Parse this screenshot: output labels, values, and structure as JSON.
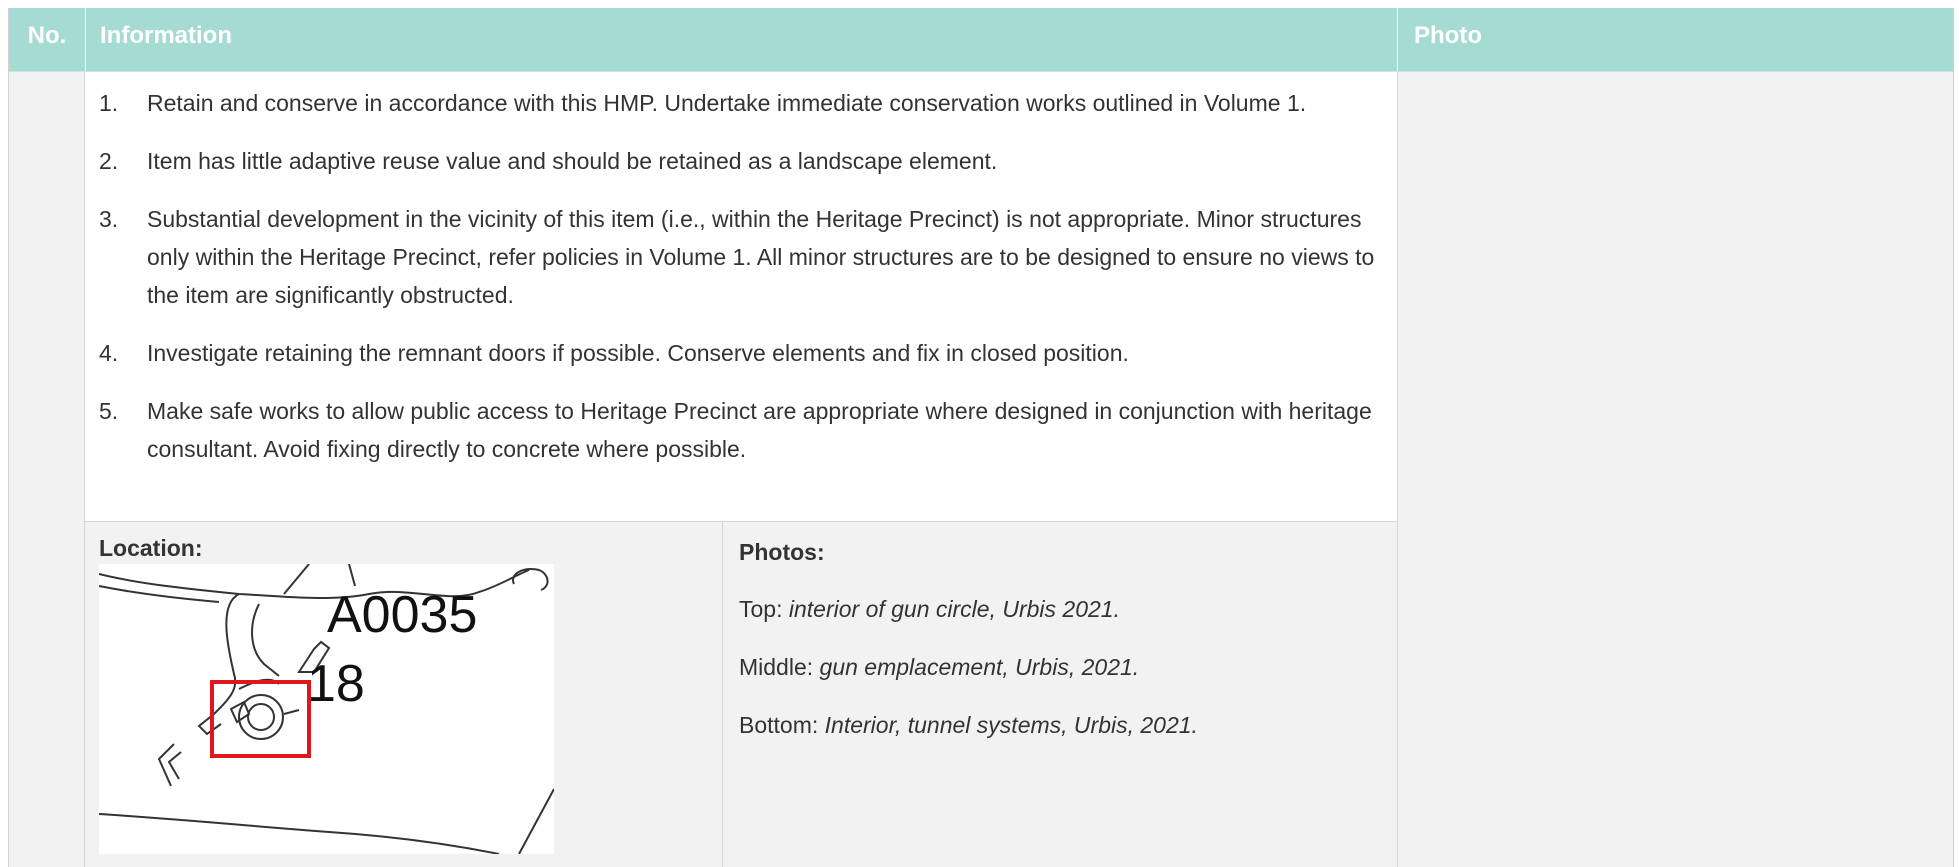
{
  "header": {
    "no": "No.",
    "information": "Information",
    "photo": "Photo"
  },
  "policies": [
    {
      "num": "1.",
      "text": "Retain and conserve in accordance with this HMP. Undertake immediate conservation works outlined in Volume 1."
    },
    {
      "num": "2.",
      "text": "Item has little adaptive reuse value and should be retained as a landscape element."
    },
    {
      "num": "3.",
      "text": "Substantial development in the vicinity of this item (i.e., within the Heritage Precinct) is not appropriate. Minor structures only within the Heritage Precinct, refer policies in Volume 1. All minor structures are to be designed to ensure no views to the item are significantly obstructed."
    },
    {
      "num": "4.",
      "text": "Investigate retaining the remnant doors if possible. Conserve elements and fix in closed position."
    },
    {
      "num": "5.",
      "text": "Make safe works to allow public access to Heritage Precinct are appropriate where designed in conjunction with heritage consultant. Avoid fixing directly to concrete where possible."
    }
  ],
  "location": {
    "label": "Location:",
    "map": {
      "area_label": "A0035",
      "item_label": "18",
      "highlight_color": "#e0161b"
    }
  },
  "photos": {
    "label": "Photos:",
    "lines": [
      {
        "prefix": "Top: ",
        "caption": "interior of gun circle, Urbis 2021."
      },
      {
        "prefix": "Middle: ",
        "caption": "gun emplacement, Urbis, 2021."
      },
      {
        "prefix": "Bottom: ",
        "caption": "Interior, tunnel systems, Urbis, 2021."
      }
    ]
  },
  "colors": {
    "header_bg": "#a6dbd4",
    "header_text": "#ffffff",
    "panel_bg": "#f2f2f2"
  }
}
